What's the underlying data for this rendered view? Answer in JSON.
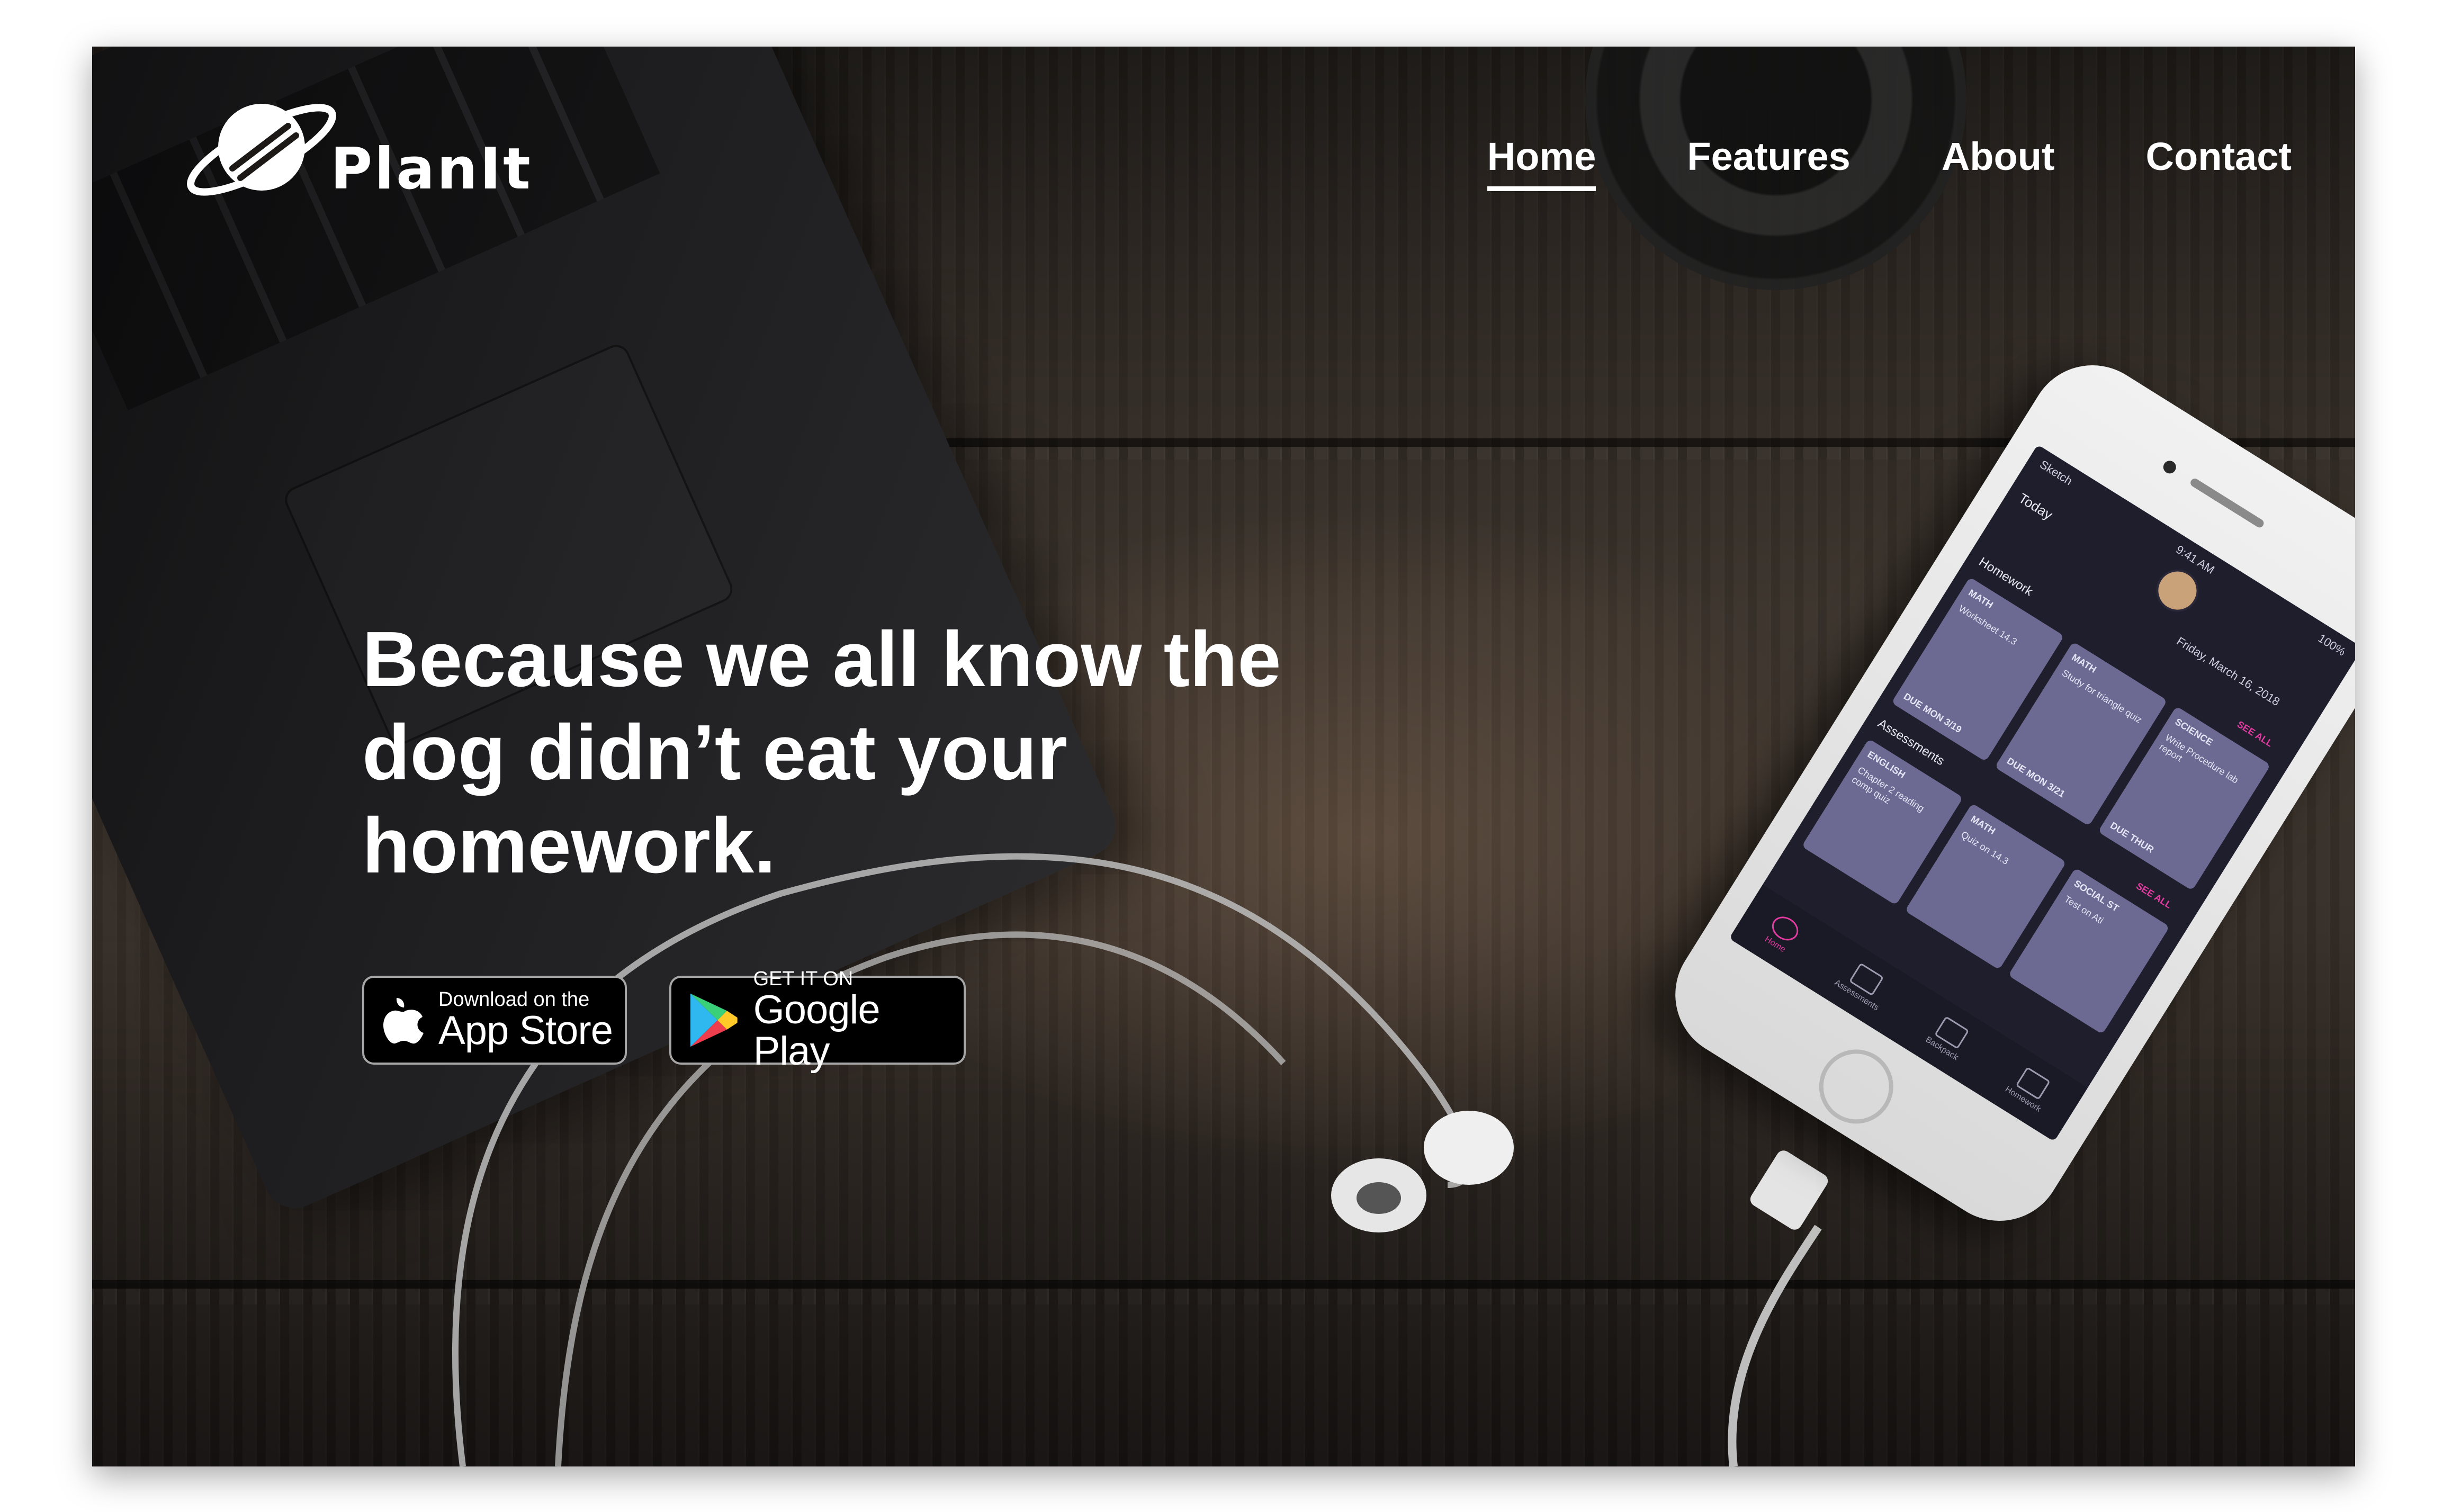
{
  "brand": {
    "name": "PlanIt"
  },
  "nav": {
    "items": [
      {
        "label": "Home",
        "active": true
      },
      {
        "label": "Features",
        "active": false
      },
      {
        "label": "About",
        "active": false
      },
      {
        "label": "Contact",
        "active": false
      }
    ]
  },
  "hero": {
    "headline": "Because we all know the dog didn’t eat your homework."
  },
  "badges": {
    "app_store": {
      "small": "Download on the",
      "big": "App Store",
      "icon": "apple-icon"
    },
    "google_play": {
      "small": "GET IT ON",
      "big": "Google Play",
      "icon": "google-play-icon"
    }
  },
  "phone_screen": {
    "status_left": "Sketch",
    "time": "9:41 AM",
    "battery": "100%",
    "today": "Today",
    "date": "Friday, March 16, 2018",
    "homework_title": "Homework",
    "assessments_title": "Assessments",
    "see_all": "SEE ALL",
    "homework_cards": [
      {
        "subject": "MATH",
        "task": "Worksheet 14.3",
        "due": "DUE MON 3/19"
      },
      {
        "subject": "MATH",
        "task": "Study for triangle quiz",
        "due": "DUE MON 3/21"
      },
      {
        "subject": "SCIENCE",
        "task": "Write Procedure lab report",
        "due": "DUE THUR"
      }
    ],
    "assessment_cards": [
      {
        "subject": "ENGLISH",
        "task": "Chapter 2 reading comp quiz"
      },
      {
        "subject": "MATH",
        "task": "Quiz on 14.3"
      },
      {
        "subject": "SOCIAL ST",
        "task": "Test on Ati"
      }
    ],
    "tabs": [
      "Home",
      "Assessments",
      "Backpack",
      "Homework"
    ]
  },
  "colors": {
    "text": "#ffffff",
    "badge_bg": "#000000",
    "badge_border": "#a6a6a6",
    "app_accent": "#e23ba0",
    "app_card": "#6c6a92"
  }
}
